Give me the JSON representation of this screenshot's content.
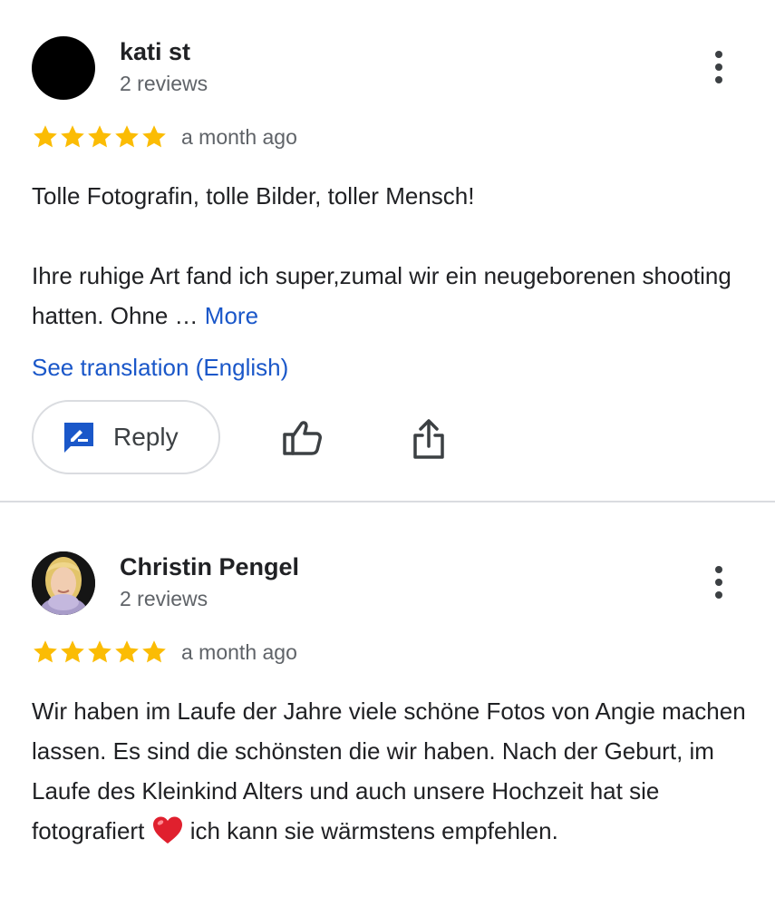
{
  "reviews": [
    {
      "author": "kati st",
      "review_count": "2 reviews",
      "rating": 5,
      "date": "a month ago",
      "text_p1": "Tolle Fotografin, tolle Bilder, toller Mensch!",
      "text_p2": "Ihre ruhige Art fand ich super,zumal wir ein neugeborenen shooting hatten. Ohne … ",
      "more_label": "More",
      "translation_label": "See translation (English)",
      "reply_label": "Reply"
    },
    {
      "author": "Christin Pengel",
      "review_count": "2 reviews",
      "rating": 5,
      "date": "a month ago",
      "text_before_heart": "Wir haben im Laufe der Jahre viele schöne Fotos von Angie machen lassen. Es sind die schönsten die wir haben. Nach der Geburt, im Laufe des Kleinkind Alters und auch unsere Hochzeit hat sie fotografiert ",
      "text_after_heart": " ich kann sie wärmstens empfehlen."
    }
  ],
  "colors": {
    "star": "#fbbc04",
    "link": "#1a57c9",
    "secondary_text": "#5f6368",
    "divider": "#dadce0"
  },
  "icons": {
    "menu": "more-vert-icon",
    "reply": "reply-icon",
    "like": "thumb-up-icon",
    "share": "share-icon",
    "heart": "heart-icon"
  }
}
